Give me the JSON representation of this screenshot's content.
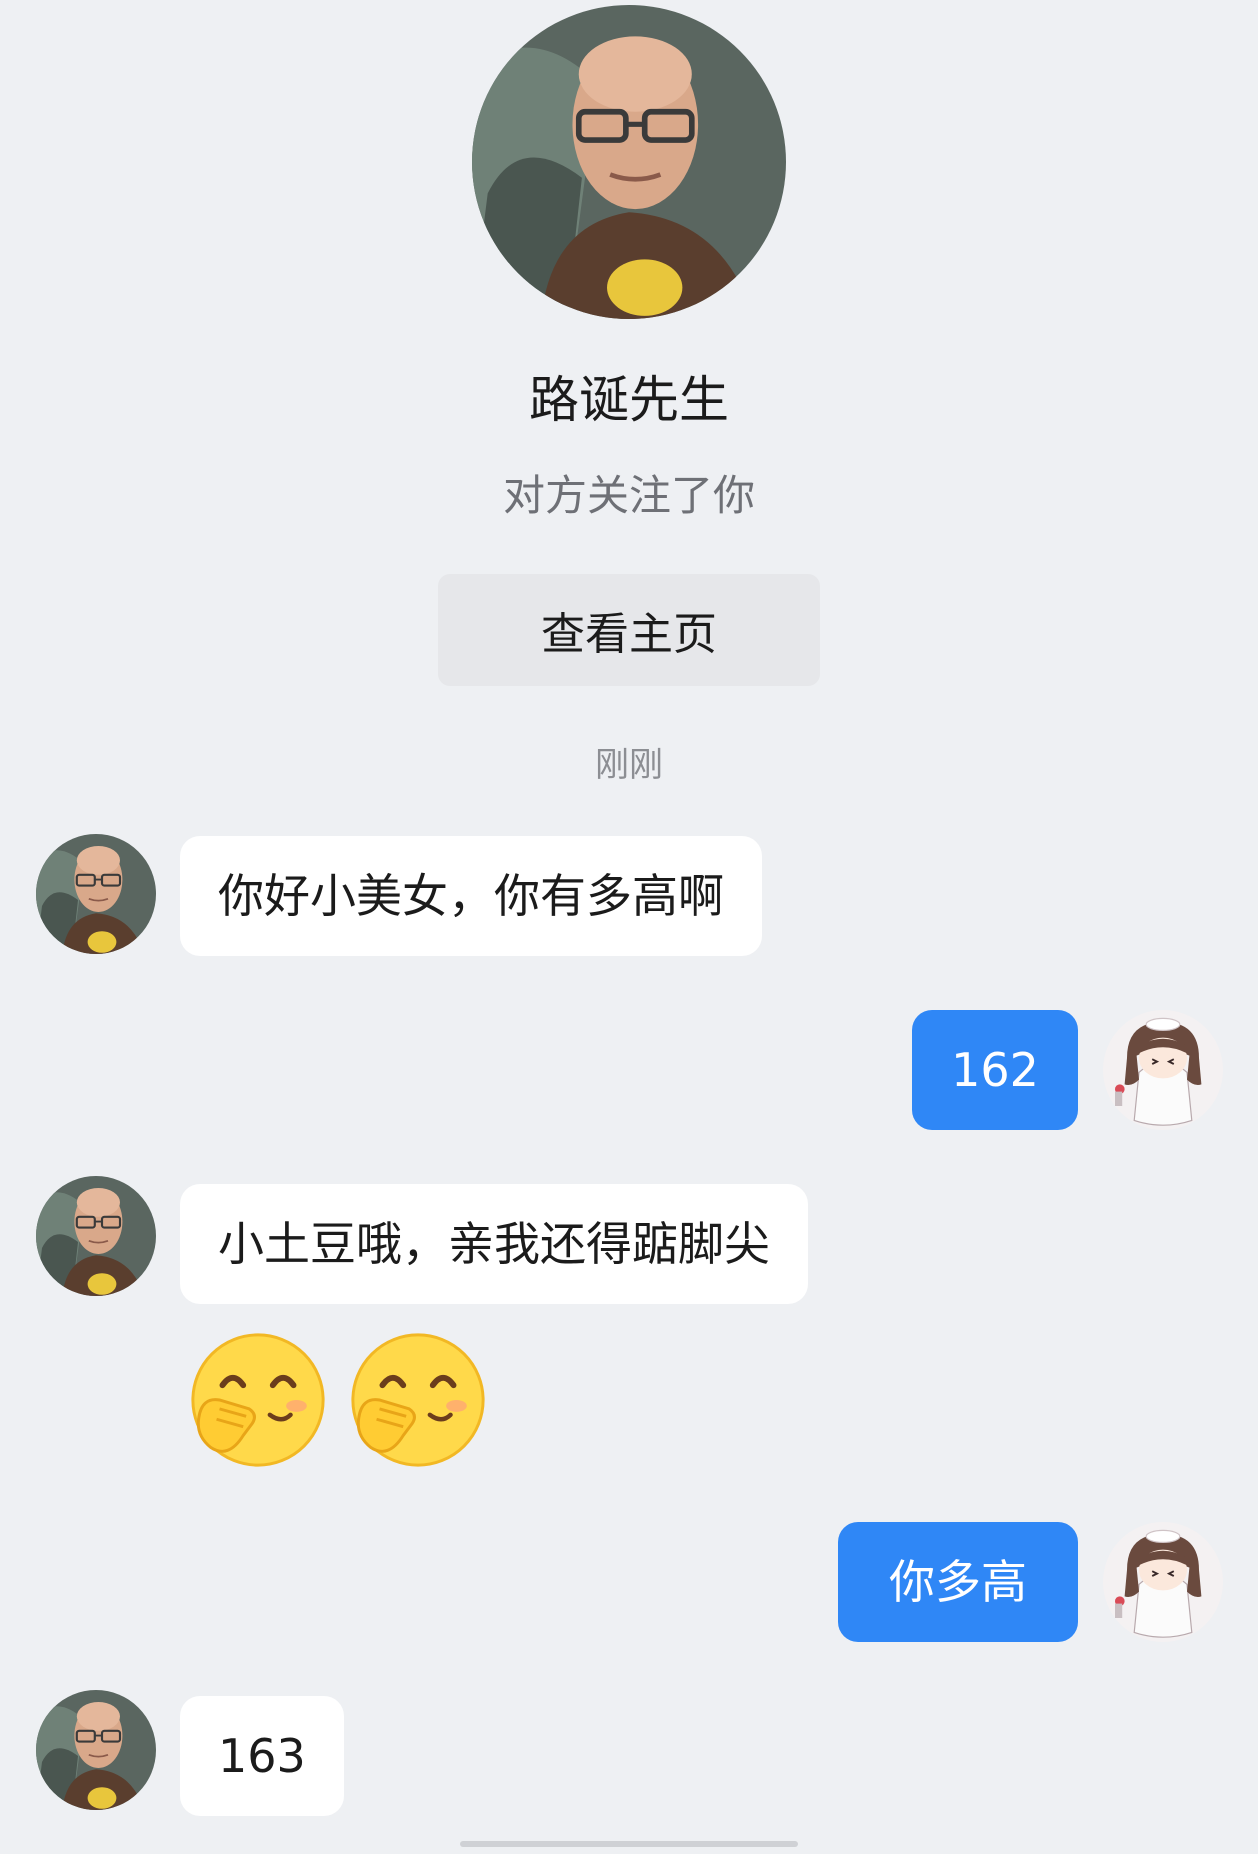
{
  "profile": {
    "name": "路诞先生",
    "subtitle": "对方关注了你",
    "button_label": "查看主页"
  },
  "timestamp": "刚刚",
  "messages": [
    {
      "from": "other",
      "text": "你好小美女，你有多高啊"
    },
    {
      "from": "me",
      "text": "162"
    },
    {
      "from": "other",
      "text": "小土豆哦，亲我还得踮脚尖"
    },
    {
      "from": "other",
      "emoji": "hand-over-mouth-smiling-emoji",
      "count": 2
    },
    {
      "from": "me",
      "text": "你多高"
    },
    {
      "from": "other",
      "text": "163"
    }
  ],
  "colors": {
    "background": "#eef0f3",
    "outgoing_bubble": "#2f87f6",
    "incoming_bubble": "#ffffff"
  },
  "icons": {
    "other_avatar": "bald-man-with-glasses-avatar",
    "my_avatar": "anime-girl-avatar"
  }
}
